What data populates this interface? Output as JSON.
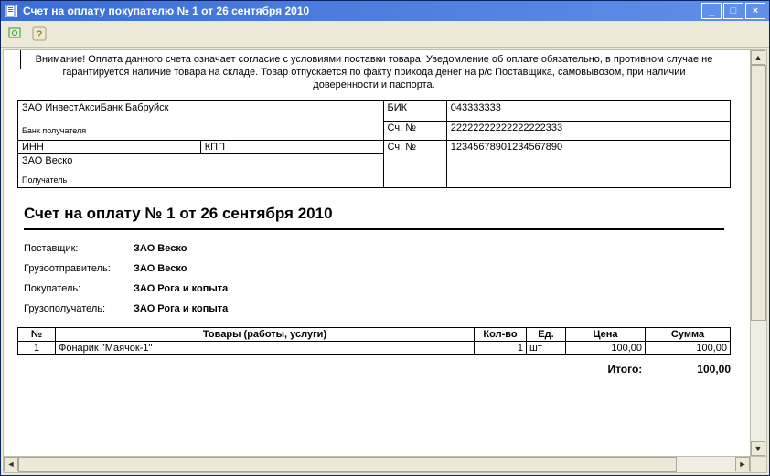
{
  "window": {
    "title": "Счет на оплату покупателю № 1 от 26 сентября 2010"
  },
  "document": {
    "notice": "Внимание! Оплата данного счета означает согласие с условиями поставки товара. Уведомление об оплате обязательно, в противном случае не гарантируется наличие товара на складе. Товар отпускается по факту прихода денег на р/с Поставщика, самовывозом, при наличии доверенности и паспорта.",
    "bank": {
      "payee_bank": "ЗАО ИнвестАксиБанк Бабруйск",
      "payee_bank_label": "Банк получателя",
      "bik_label": "БИК",
      "bik": "043333333",
      "corr_account_label": "Сч. №",
      "corr_account": "22222222222222222333",
      "inn_label": "ИНН",
      "inn": "",
      "kpp_label": "КПП",
      "kpp": "",
      "settlement_account_label": "Сч. №",
      "settlement_account": "12345678901234567890",
      "payee": "ЗАО Веско",
      "payee_label": "Получатель"
    },
    "title": "Счет на оплату № 1 от 26 сентября 2010",
    "parties": {
      "supplier_label": "Поставщик:",
      "supplier": "ЗАО Веско",
      "shipper_label": "Грузоотправитель:",
      "shipper": "ЗАО Веско",
      "buyer_label": "Покупатель:",
      "buyer": "ЗАО Рога и копыта",
      "consignee_label": "Грузополучатель:",
      "consignee": "ЗАО Рога и копыта"
    },
    "items_header": {
      "num": "№",
      "name": "Товары (работы, услуги)",
      "qty": "Кол-во",
      "unit": "Ед.",
      "price": "Цена",
      "sum": "Сумма"
    },
    "items": [
      {
        "num": "1",
        "name": "Фонарик \"Маячок-1\"",
        "qty": "1",
        "unit": "шт",
        "price": "100,00",
        "sum": "100,00"
      }
    ],
    "totals": {
      "label": "Итого:",
      "value": "100,00"
    }
  }
}
